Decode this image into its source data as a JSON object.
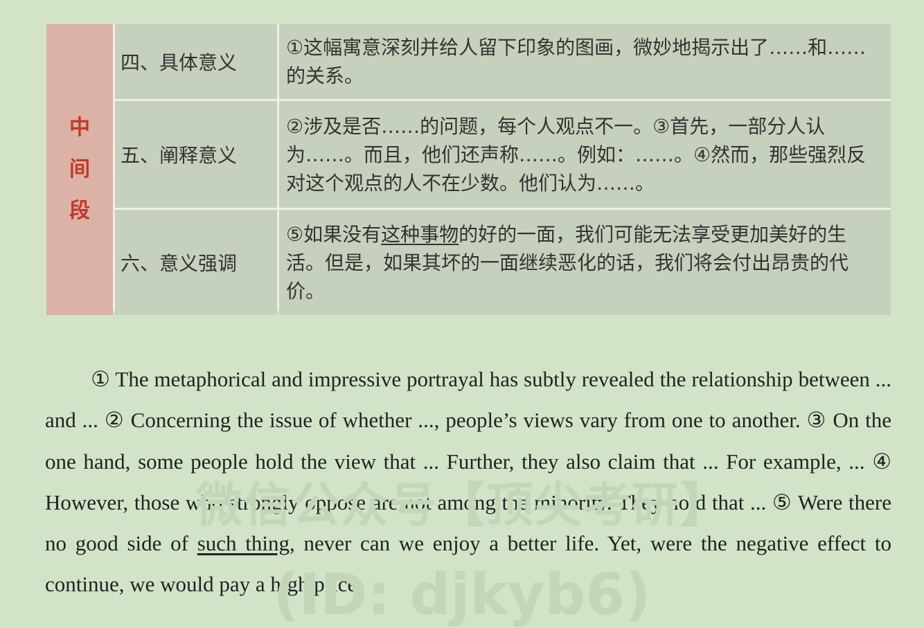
{
  "table": {
    "section_label": [
      "中",
      "间",
      "段"
    ],
    "rows": [
      {
        "label": "四、具体意义",
        "text": "①这幅寓意深刻并给人留下印象的图画，微妙地揭示出了……和……的关系。"
      },
      {
        "label": "五、阐释意义",
        "text": "②涉及是否……的问题，每个人观点不一。③首先，一部分人认为……。而且，他们还声称……。例如：……。④然而，那些强烈反对这个观点的人不在少数。他们认为……。"
      },
      {
        "label": "六、意义强调",
        "text_before": "⑤如果没有",
        "text_underlined": "这种事物",
        "text_after": "的好的一面，我们可能无法享受更加美好的生活。但是，如果其坏的一面继续恶化的话，我们将会付出昂贵的代价。"
      }
    ]
  },
  "paragraph": {
    "before": "① The metaphorical and impressive portrayal has subtly revealed the relationship between ... and ... ② Concerning the issue of whether ..., people’s views vary from one to another. ③ On the one hand, some people hold the view that ... Further, they also claim that ... For example, ... ④ However, those who strongly oppose are not among the minority. They hold that ... ⑤ Were there no good side of ",
    "underlined": "such thing",
    "after": ", never can we enjoy a better life. Yet, were the negative effect to continue, we would pay a high price."
  },
  "watermark": {
    "line1": "微信公众号【顶尖考研】",
    "line2": "(ID: djkyb6)"
  }
}
